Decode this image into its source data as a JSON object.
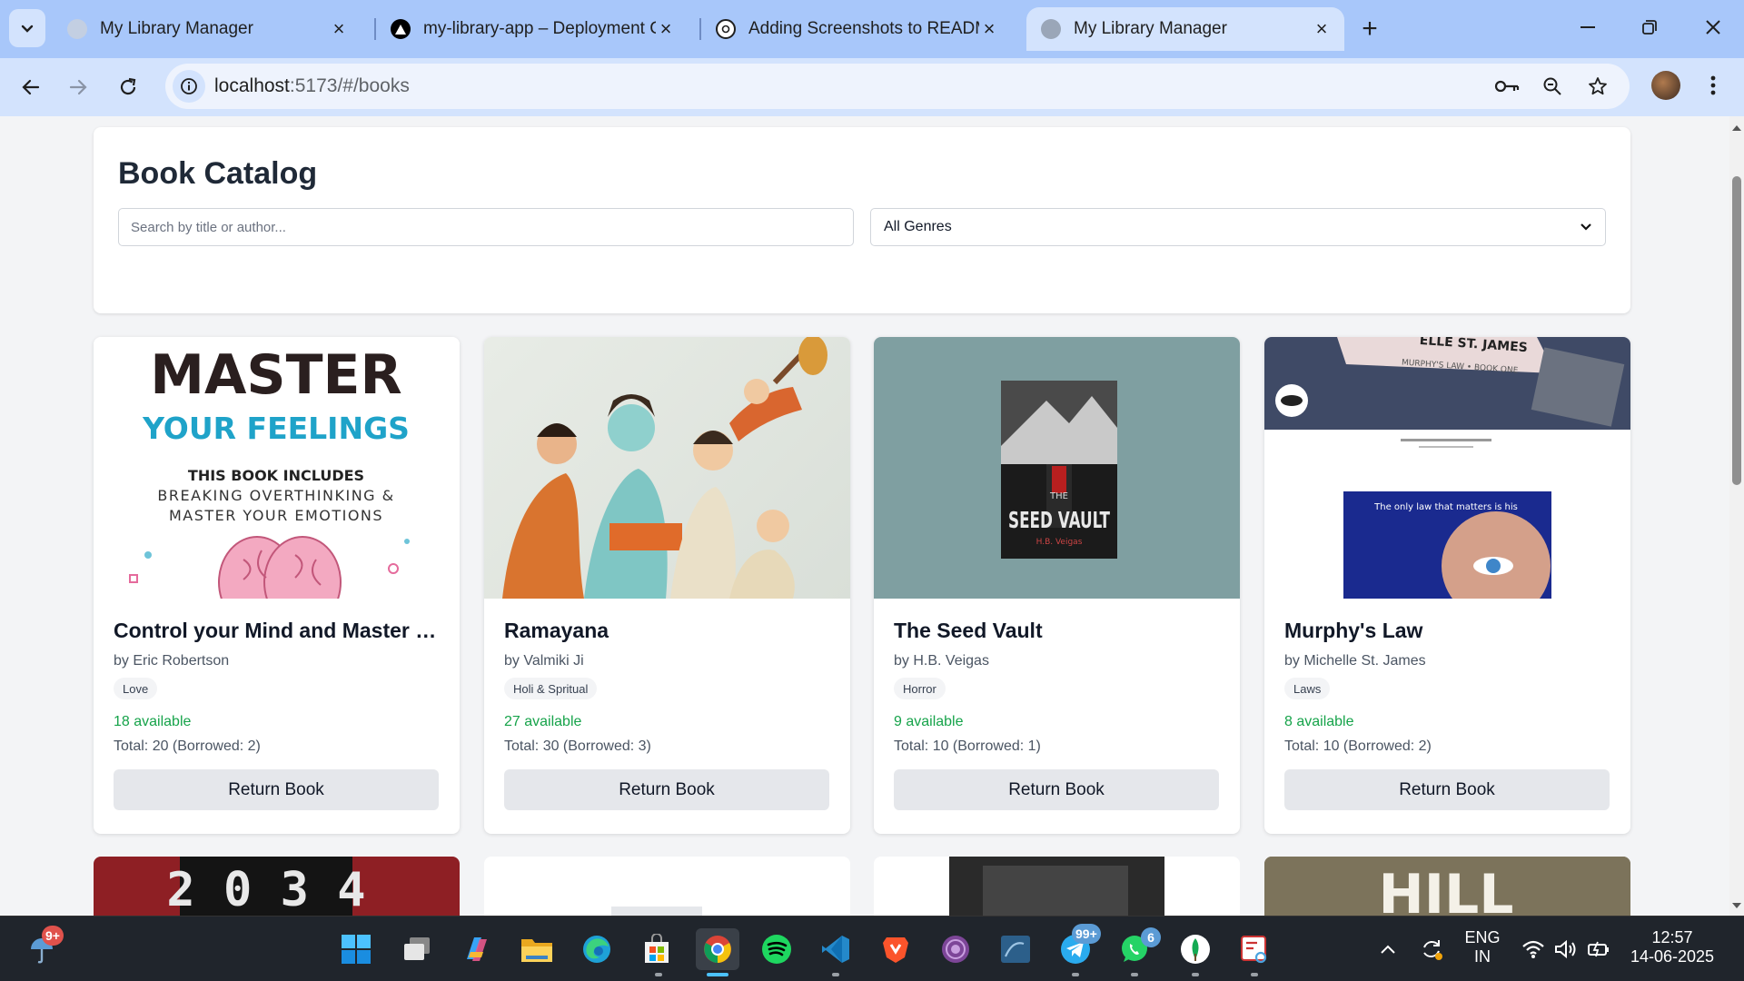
{
  "browser": {
    "tabs": [
      {
        "title": "My Library Manager",
        "active": false
      },
      {
        "title": "my-library-app – Deployment C",
        "active": false
      },
      {
        "title": "Adding Screenshots to READMI",
        "active": false
      },
      {
        "title": "My Library Manager",
        "active": true
      }
    ],
    "url_host": "localhost",
    "url_path": ":5173/#/books"
  },
  "catalog": {
    "title": "Book Catalog",
    "search_placeholder": "Search by title or author...",
    "genre_selected": "All Genres"
  },
  "books": [
    {
      "title": "Control your Mind and Master y...",
      "author": "by Eric Robertson",
      "genre": "Love",
      "available": "18 available",
      "total": "Total: 20 (Borrowed: 2)",
      "button": "Return Book",
      "cover_text": {
        "l1": "MASTER",
        "l2": "YOUR FEELINGS",
        "l3": "THIS BOOK INCLUDES",
        "l4": "BREAKING OVERTHINKING &",
        "l5": "MASTER YOUR EMOTIONS"
      }
    },
    {
      "title": "Ramayana",
      "author": "by Valmiki Ji",
      "genre": "Holi & Spritual",
      "available": "27 available",
      "total": "Total: 30 (Borrowed: 3)",
      "button": "Return Book"
    },
    {
      "title": "The Seed Vault",
      "author": "by H.B. Veigas",
      "genre": "Horror",
      "available": "9 available",
      "total": "Total: 10 (Borrowed: 1)",
      "button": "Return Book",
      "cover_text": {
        "l1": "THE",
        "l2": "SEED VAULT",
        "l3": "H.B. Veigas"
      }
    },
    {
      "title": "Murphy's Law",
      "author": "by Michelle St. James",
      "genre": "Laws",
      "available": "8 available",
      "total": "Total: 10 (Borrowed: 2)",
      "button": "Return Book",
      "cover_text": {
        "l1": "ELLE ST. JAMES",
        "l2": "MURPHY'S LAW • BOOK ONE",
        "l3": "The only law that matters is his"
      }
    }
  ],
  "row2_covers": [
    {
      "text": "2 0 3 4"
    },
    {
      "text": ""
    },
    {
      "text": ""
    },
    {
      "text": "HILL"
    }
  ],
  "taskbar": {
    "weather_badge": "9+",
    "telegram_badge": "99+",
    "whatsapp_badge": "6",
    "lang": "ENG",
    "region": "IN",
    "time": "12:57",
    "date": "14-06-2025"
  },
  "colors": {
    "tabstrip": "#a8c7fa",
    "toolbar": "#d3e3fd",
    "available_green": "#16a34a",
    "button_gray": "#e5e7eb"
  }
}
